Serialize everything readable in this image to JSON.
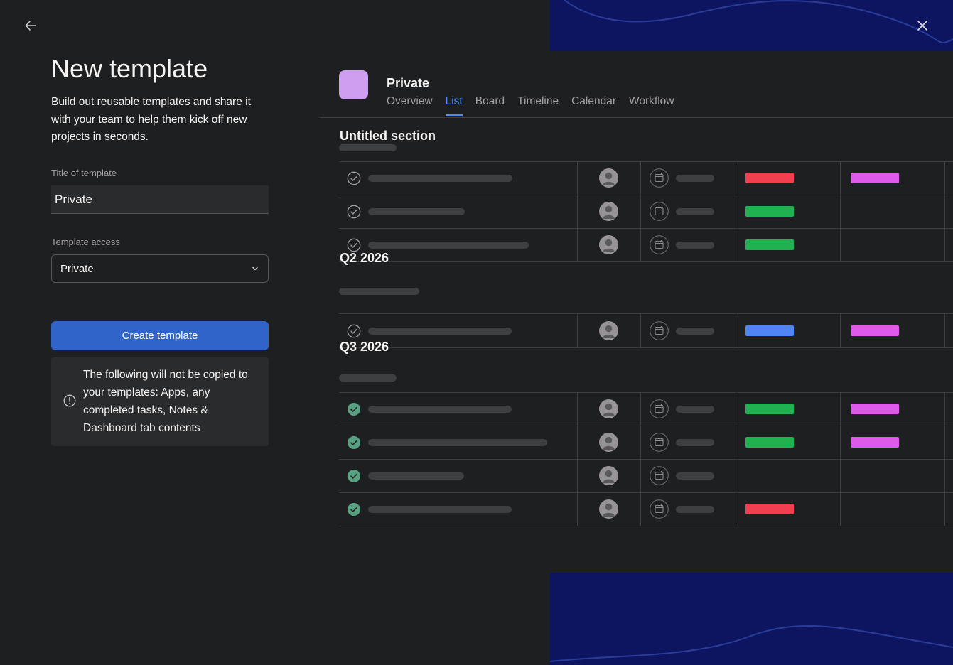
{
  "header": {
    "back_icon": "arrow-left-icon",
    "close_icon": "close-icon"
  },
  "form": {
    "title": "New template",
    "subtitle": "Build out reusable templates and share it with your team to help them kick off new projects in seconds.",
    "title_label": "Title of template",
    "title_value": "Private",
    "access_label": "Template access",
    "access_value": "Private",
    "create_label": "Create template",
    "notice": "The following will not be copied to your templates: Apps, any completed tasks, Notes & Dashboard tab contents"
  },
  "preview": {
    "project_name": "Private",
    "project_color": "#cf9ef0",
    "tabs": [
      "Overview",
      "List",
      "Board",
      "Timeline",
      "Calendar",
      "Workflow"
    ],
    "active_tab": "List",
    "sections": [
      "Untitled section",
      "Q2 2026",
      "Q3 2026"
    ]
  },
  "colors": {
    "red": "#f0404f",
    "green": "#20b251",
    "blue": "#4f86f4",
    "magenta": "#de5ae8",
    "accent": "#3164c8"
  }
}
